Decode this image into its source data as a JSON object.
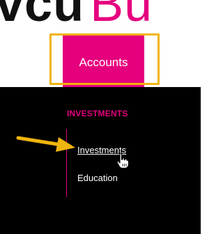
{
  "header": {
    "logo_dark_text": "vcu",
    "logo_accent_text": "Bu",
    "accent_color": "#e6007e",
    "highlight_color": "#f0b40f"
  },
  "nav": {
    "accounts_label": "Accounts"
  },
  "menu": {
    "section_heading": "INVESTMENTS",
    "items": [
      {
        "label": "Investments"
      },
      {
        "label": "Education"
      }
    ]
  },
  "annotations": {
    "arrow_icon": "arrow-right-icon",
    "cursor_icon": "hand-pointer-icon"
  }
}
